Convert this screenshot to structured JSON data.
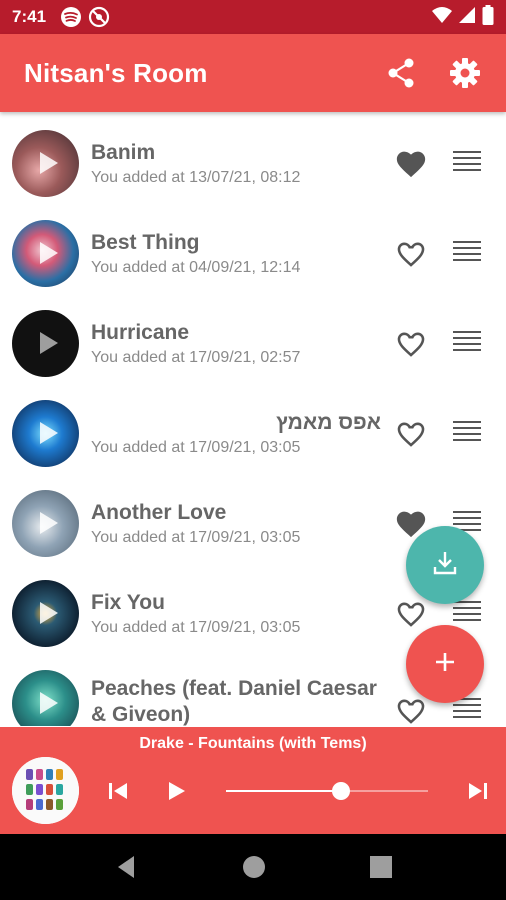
{
  "status_bar": {
    "time": "7:41",
    "icons": [
      "spotify-icon",
      "no-entry-icon",
      "wifi-icon",
      "signal-icon",
      "battery-icon"
    ]
  },
  "app_bar": {
    "title": "Nitsan's Room",
    "actions": [
      "share-icon",
      "settings-icon"
    ]
  },
  "songs": [
    {
      "title": "Banim",
      "subtitle": "You added at 13/07/21, 08:12",
      "liked": true,
      "rtl": false
    },
    {
      "title": "Best Thing",
      "subtitle": "You added at 04/09/21, 12:14",
      "liked": false,
      "rtl": false
    },
    {
      "title": "Hurricane",
      "subtitle": "You added at 17/09/21, 02:57",
      "liked": false,
      "rtl": false
    },
    {
      "title": "אפס מאמץ",
      "subtitle": "You added at 17/09/21, 03:05",
      "liked": false,
      "rtl": true
    },
    {
      "title": "Another Love",
      "subtitle": "You added at 17/09/21, 03:05",
      "liked": true,
      "rtl": false
    },
    {
      "title": "Fix You",
      "subtitle": "You added at 17/09/21, 03:05",
      "liked": false,
      "rtl": false
    },
    {
      "title": "Peaches (feat. Daniel Caesar & Giveon)",
      "subtitle": "",
      "liked": false,
      "rtl": false
    }
  ],
  "fabs": {
    "download": "download-icon",
    "add": "plus-icon"
  },
  "player": {
    "now_playing": "Drake - Fountains (with Tems)",
    "progress": 0.57,
    "controls": [
      "skip-previous-icon",
      "play-icon",
      "skip-next-icon"
    ]
  },
  "nav": [
    "back-icon",
    "home-icon",
    "recents-icon"
  ],
  "colors": {
    "status_bar": "#b71c2c",
    "primary": "#ef5350",
    "fab_download": "#4db6ac",
    "text_title": "#666666",
    "text_sub": "#8a8a8a"
  }
}
